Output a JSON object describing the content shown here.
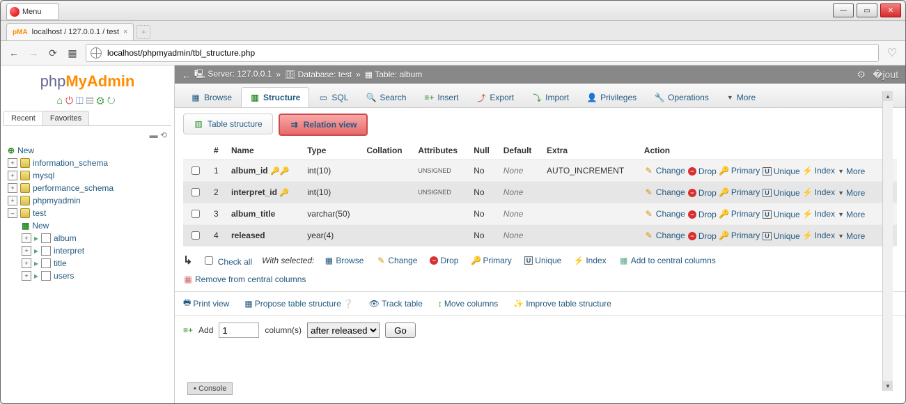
{
  "browser": {
    "menu_label": "Menu",
    "tab_title": "localhost / 127.0.0.1 / test",
    "url": "localhost/phpmyadmin/tbl_structure.php"
  },
  "logo": {
    "php": "php",
    "my": "My",
    "admin": "Admin"
  },
  "side_tabs": {
    "recent": "Recent",
    "favorites": "Favorites"
  },
  "tree": {
    "new": "New",
    "dbs": [
      "information_schema",
      "mysql",
      "performance_schema",
      "phpmyadmin",
      "test"
    ],
    "test_children_new": "New",
    "test_tables": [
      "album",
      "interpret",
      "title",
      "users"
    ]
  },
  "breadcrumb": {
    "server": "Server: 127.0.0.1",
    "database": "Database: test",
    "table": "Table: album"
  },
  "topmenu": [
    "Browse",
    "Structure",
    "SQL",
    "Search",
    "Insert",
    "Export",
    "Import",
    "Privileges",
    "Operations",
    "More"
  ],
  "subtabs": {
    "table_structure": "Table structure",
    "relation_view": "Relation view"
  },
  "headers": {
    "num": "#",
    "name": "Name",
    "type": "Type",
    "collation": "Collation",
    "attributes": "Attributes",
    "null": "Null",
    "default": "Default",
    "extra": "Extra",
    "action": "Action"
  },
  "columns": [
    {
      "num": "1",
      "name": "album_id",
      "keys": "pk_idx",
      "type": "int(10)",
      "collation": "",
      "attributes": "UNSIGNED",
      "null": "No",
      "default": "None",
      "extra": "AUTO_INCREMENT"
    },
    {
      "num": "2",
      "name": "interpret_id",
      "keys": "idx",
      "type": "int(10)",
      "collation": "",
      "attributes": "UNSIGNED",
      "null": "No",
      "default": "None",
      "extra": ""
    },
    {
      "num": "3",
      "name": "album_title",
      "keys": "",
      "type": "varchar(50)",
      "collation": "",
      "attributes": "",
      "null": "No",
      "default": "None",
      "extra": ""
    },
    {
      "num": "4",
      "name": "released",
      "keys": "",
      "type": "year(4)",
      "collation": "",
      "attributes": "",
      "null": "No",
      "default": "None",
      "extra": ""
    }
  ],
  "row_actions": {
    "change": "Change",
    "drop": "Drop",
    "primary": "Primary",
    "unique": "Unique",
    "index": "Index",
    "more": "More"
  },
  "batch": {
    "check_all": "Check all",
    "with_selected": "With selected:",
    "browse": "Browse",
    "change": "Change",
    "drop": "Drop",
    "primary": "Primary",
    "unique": "Unique",
    "index": "Index",
    "add_central": "Add to central columns",
    "remove_central": "Remove from central columns"
  },
  "links": {
    "print": "Print view",
    "propose": "Propose table structure",
    "track": "Track table",
    "move": "Move columns",
    "improve": "Improve table structure"
  },
  "add": {
    "label": "Add",
    "count": "1",
    "cols": "column(s)",
    "position": "after released",
    "go": "Go"
  },
  "console": "Console"
}
